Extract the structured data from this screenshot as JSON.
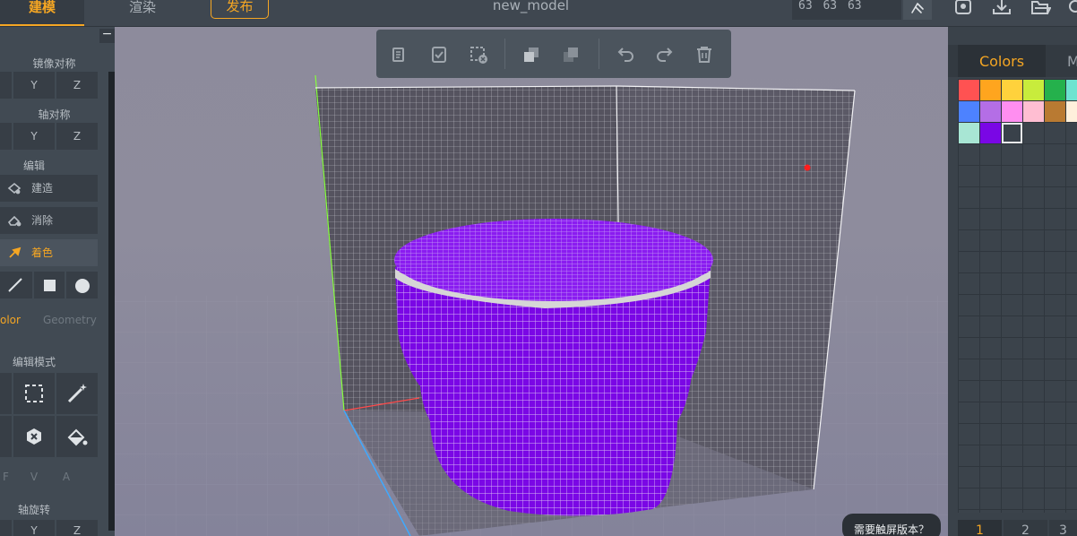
{
  "tabs": [
    "建模",
    "渲染"
  ],
  "publish_label": "发布",
  "model_name": "new_model",
  "dimensions": "63 63 63",
  "left_panel": {
    "collapse_label": "−",
    "mirror_label": "镜像对称",
    "mirror_axes": [
      "Y",
      "Z"
    ],
    "axis_sym_label": "轴对称",
    "axis_sym_axes": [
      "Y",
      "Z"
    ],
    "edit_label": "编辑",
    "build_label": "建造",
    "erase_label": "消除",
    "paint_label": "着色",
    "sub_tabs": [
      "olor",
      "Geometry"
    ],
    "edit_mode_label": "编辑模式",
    "fva": [
      "F",
      "V",
      "A"
    ],
    "axis_rotate_label": "轴旋转",
    "rotate_axes": [
      "Y",
      "Z"
    ]
  },
  "touch_tip": "需要触屏版本？",
  "right_panel": {
    "tab_colors": "Colors",
    "tab_other": "M",
    "palette": [
      "#ff5252",
      "#ffa51e",
      "#ffd23c",
      "#c8ec3c",
      "#25b14c",
      "#6ee3d0",
      "#4d82ff",
      "#b46ee6",
      "#ff8ef0",
      "#ffbed2",
      "#b97a32",
      "#fff0dc",
      "#a8e6d4",
      "#7a07e5",
      "#39414a"
    ],
    "layers": [
      "1",
      "2",
      "3"
    ]
  },
  "scene": {
    "voxel_color": "#7a07e5",
    "stripe_color": "#d6d6d6"
  }
}
